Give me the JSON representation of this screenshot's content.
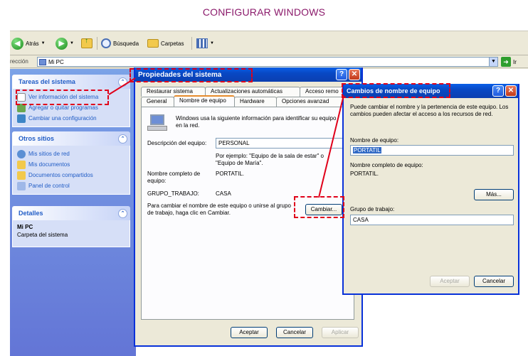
{
  "page_title": "CONFIGURAR WINDOWS",
  "toolbar": {
    "back": "Atrás",
    "search": "Búsqueda",
    "folders": "Carpetas"
  },
  "address": {
    "label": "rección",
    "value": "Mi PC",
    "go": "Ir"
  },
  "taskpane": {
    "system_tasks": {
      "title": "Tareas del sistema",
      "items": [
        "Ver información del sistema",
        "Agregar o quitar programas",
        "Cambiar una configuración"
      ]
    },
    "other_places": {
      "title": "Otros sitios",
      "items": [
        "Mis sitios de red",
        "Mis documentos",
        "Documentos compartidos",
        "Panel de control"
      ]
    },
    "details": {
      "title": "Detalles",
      "name": "Mi PC",
      "desc": "Carpeta del sistema"
    }
  },
  "sysprops": {
    "title": "Propiedades del sistema",
    "tabs_back": [
      "Restaurar sistema",
      "Actualizaciones automáticas",
      "Acceso remo"
    ],
    "tabs_front": [
      "General",
      "Nombre de equipo",
      "Hardware",
      "Opciones avanzad"
    ],
    "intro": "Windows usa la siguiente información para identificar su equipo en la red.",
    "desc_label": "Descripción del equipo:",
    "desc_value": "PERSONAL",
    "example": "Por ejemplo: \"Equipo de la sala de estar\" o \"Equipo de María\".",
    "fullname_label": "Nombre completo de equipo:",
    "fullname_value": "PORTATIL.",
    "workgroup_label": "GRUPO_TRABAJO:",
    "workgroup_value": "CASA",
    "change_text": "Para cambiar el nombre de este equipo o unirse al grupo de trabajo, haga clic en Cambiar.",
    "change_button": "Cambiar...",
    "ok": "Aceptar",
    "cancel": "Cancelar",
    "apply": "Aplicar"
  },
  "rename": {
    "title": "Cambios de nombre de equipo",
    "intro": "Puede cambiar el nombre y la pertenencia de este equipo. Los cambios pueden afectar el acceso a los recursos de red.",
    "name_label": "Nombre de equipo:",
    "name_value": "PORTATIL",
    "fullname_label": "Nombre completo de equipo:",
    "fullname_value": "PORTATIL.",
    "more": "Más...",
    "workgroup_label": "Grupo de trabajo:",
    "workgroup_value": "CASA",
    "ok": "Aceptar",
    "cancel": "Cancelar"
  },
  "colors": {
    "annotation": "#e0001a",
    "title": "#8b1a6b",
    "xp_blue": "#0848c4",
    "link": "#215dc6"
  }
}
